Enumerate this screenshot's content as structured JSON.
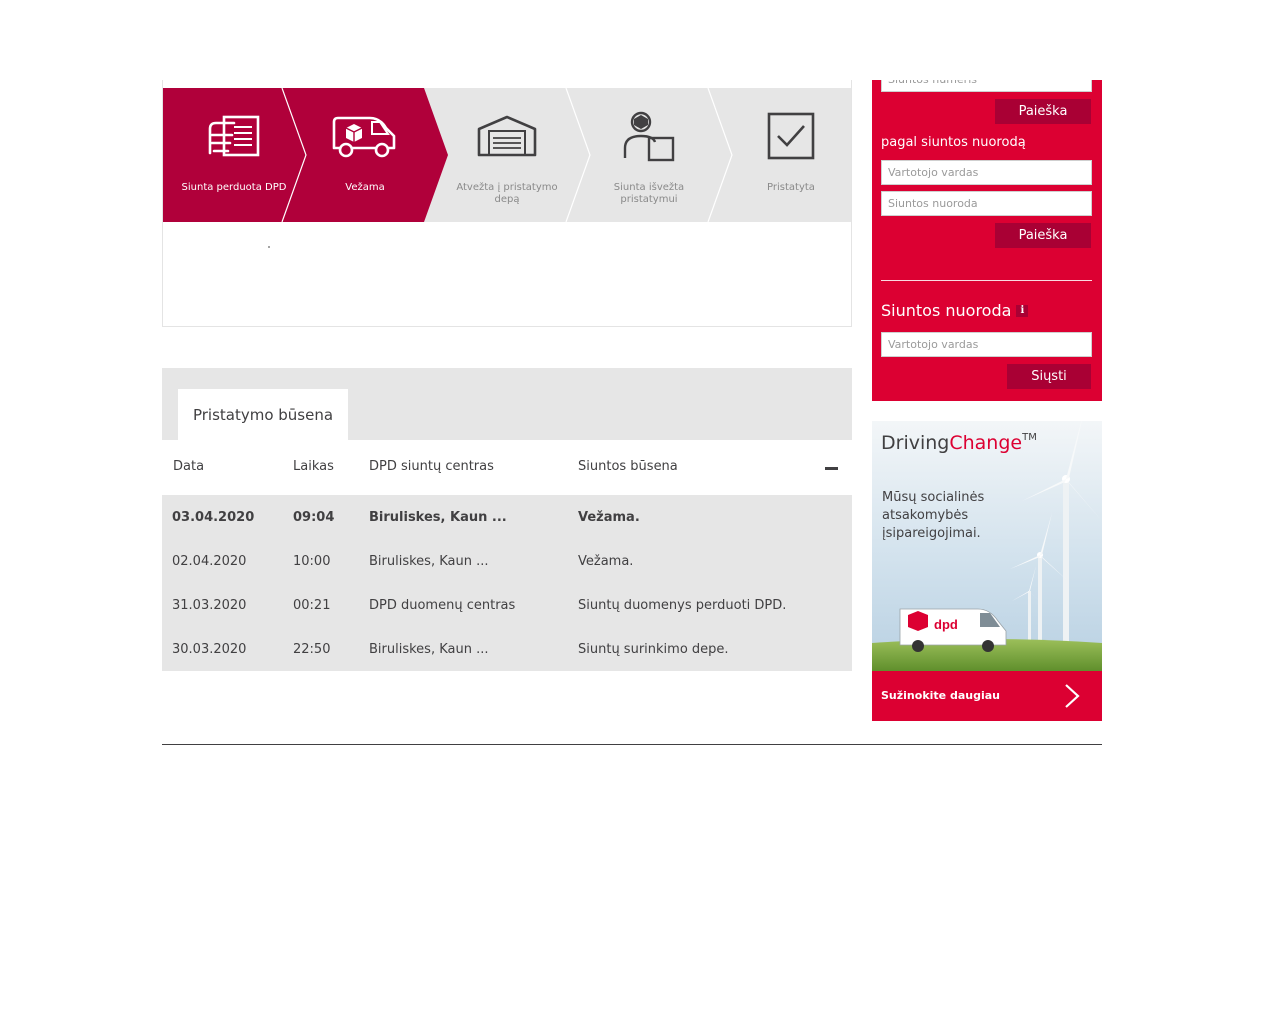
{
  "progress": {
    "steps": [
      {
        "label": "Siunta perduota DPD",
        "icon": "hand-parcel-icon",
        "done": true
      },
      {
        "label": "Vežama",
        "icon": "delivery-van-icon",
        "done": true
      },
      {
        "label": "Atvežta į pristatymo depą",
        "icon": "depot-icon",
        "done": false
      },
      {
        "label": "Siunta išvežta pristatymui",
        "icon": "courier-icon",
        "done": false
      },
      {
        "label": "Pristatyta",
        "icon": "checkbox-icon",
        "done": false
      }
    ]
  },
  "status": {
    "tab_label": "Pristatymo būsena",
    "columns": [
      "Data",
      "Laikas",
      "DPD siuntų centras",
      "Siuntos būsena"
    ],
    "rows": [
      {
        "date": "03.04.2020",
        "time": "09:04",
        "center": "Biruliskes, Kaun ...",
        "status": "Vežama.",
        "bold": true
      },
      {
        "date": "02.04.2020",
        "time": "10:00",
        "center": "Biruliskes, Kaun ...",
        "status": "Vežama.",
        "bold": false
      },
      {
        "date": "31.03.2020",
        "time": "00:21",
        "center": "DPD duomenų centras",
        "status": "Siuntų duomenys perduoti DPD.",
        "bold": false
      },
      {
        "date": "30.03.2020",
        "time": "22:50",
        "center": "Biruliskes, Kaun ...",
        "status": "Siuntų surinkimo depe.",
        "bold": false
      }
    ]
  },
  "search": {
    "parcel_number_placeholder": "Siuntos numeris",
    "search_button_1": "Paieška",
    "by_reference_label": "pagal siuntos nuorodą",
    "username_placeholder": "Vartotojo vardas",
    "reference_placeholder": "Siuntos nuoroda",
    "search_button_2": "Paieška",
    "reference_title": "Siuntos nuoroda",
    "info_glyph": "i",
    "username_placeholder_2": "Vartotojo vardas",
    "send_button": "Siųsti"
  },
  "banner": {
    "title_part1": "Driving",
    "title_part2": "Change",
    "title_tm": "TM",
    "text": "Mūsų socialinės atsakomybės įsipareigojimai.",
    "van_logo": "dpd",
    "cta": "Sužinokite daugiau"
  },
  "colors": {
    "brand_red": "#dc0032",
    "dark_red": "#a90034",
    "grey_bg": "#e6e6e6",
    "text": "#414042"
  }
}
